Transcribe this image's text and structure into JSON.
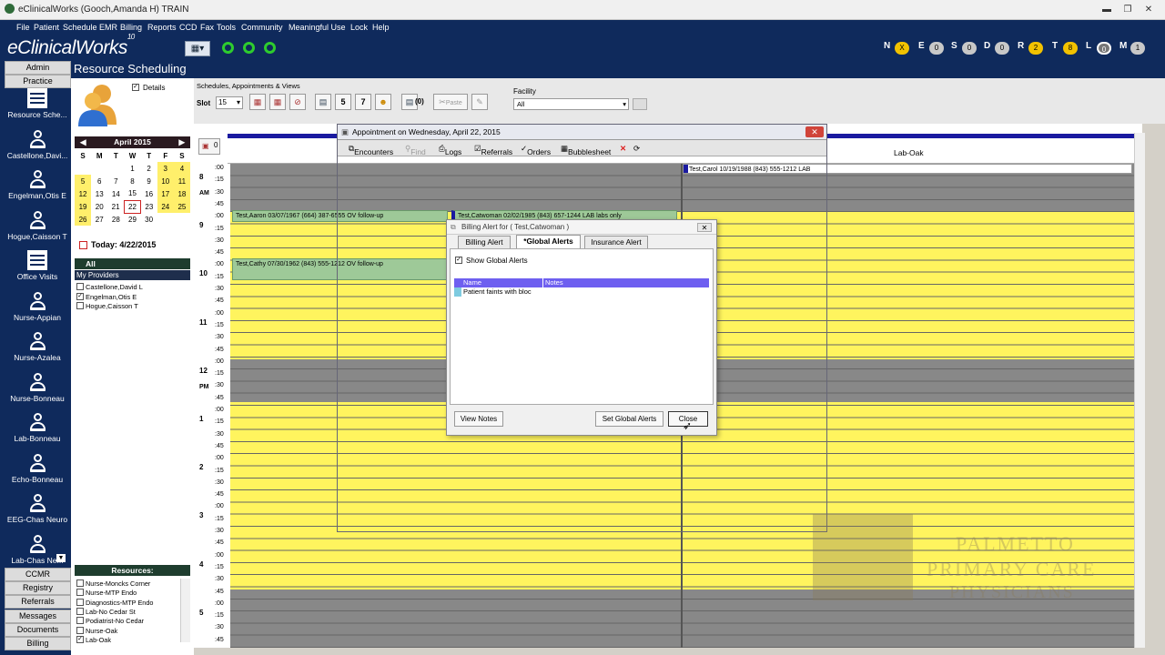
{
  "window": {
    "title": "eClinicalWorks (Gooch,Amanda H)  TRAIN",
    "minimize": "▬",
    "maximize": "❐",
    "close": "✕"
  },
  "menu": [
    "File",
    "Patient",
    "Schedule",
    "EMR",
    "Billing",
    "Reports",
    "CCD",
    "Fax",
    "Tools",
    "Community",
    "Meaningful Use",
    "Lock",
    "Help"
  ],
  "logo": {
    "name": "eClinicalWorks",
    "version": "10"
  },
  "jellybeans": [
    {
      "letter": "N",
      "count": "X",
      "style": "y"
    },
    {
      "letter": "E",
      "count": "0",
      "style": ""
    },
    {
      "letter": "S",
      "count": "0",
      "style": ""
    },
    {
      "letter": "D",
      "count": "0",
      "style": ""
    },
    {
      "letter": "R",
      "count": "2",
      "style": "y"
    },
    {
      "letter": "T",
      "count": "8",
      "style": "y"
    },
    {
      "letter": "L",
      "count": "0",
      "style": "b"
    },
    {
      "letter": "M",
      "count": "1",
      "style": ""
    }
  ],
  "nav": {
    "top_buttons": [
      "Admin",
      "Practice"
    ],
    "items": [
      "Resource Sche...",
      "Castellone,Davi...",
      "Engelman,Otis E",
      "Hogue,Caisson T",
      "Office Visits",
      "Nurse-Appian",
      "Nurse-Azalea",
      "Nurse-Bonneau",
      "Lab-Bonneau",
      "Echo-Bonneau",
      "EEG-Chas Neuro",
      "Lab-Chas Ne..."
    ],
    "bottom_buttons": [
      "CCMR",
      "Registry",
      "Referrals",
      "Messages",
      "Documents",
      "Billing"
    ]
  },
  "header": {
    "title": "Resource Scheduling"
  },
  "left_panel": {
    "details_label": "Details",
    "month": "April 2015",
    "weekdays": [
      "S",
      "M",
      "T",
      "W",
      "T",
      "F",
      "S"
    ],
    "weeks": [
      [
        "",
        "",
        "",
        "1",
        "2",
        "3",
        "4"
      ],
      [
        "5",
        "6",
        "7",
        "8",
        "9",
        "10",
        "11"
      ],
      [
        "12",
        "13",
        "14",
        "15",
        "16",
        "17",
        "18"
      ],
      [
        "19",
        "20",
        "21",
        "22",
        "23",
        "24",
        "25"
      ],
      [
        "26",
        "27",
        "28",
        "29",
        "30",
        "",
        ""
      ]
    ],
    "today_label": "Today: 4/22/2015",
    "all_label": "All",
    "my_providers_label": "My Providers",
    "providers": [
      {
        "name": "Castellone,David L",
        "checked": false
      },
      {
        "name": "Engelman,Otis E",
        "checked": true
      },
      {
        "name": "Hogue,Caisson T",
        "checked": false
      }
    ],
    "resources_label": "Resources:",
    "resources": [
      {
        "name": "Nurse-Moncks Corner",
        "checked": false
      },
      {
        "name": "Nurse-MTP Endo",
        "checked": false
      },
      {
        "name": "Diagnostics-MTP Endo",
        "checked": false
      },
      {
        "name": "Lab-No Cedar St",
        "checked": false
      },
      {
        "name": "Podiatrist-No Cedar",
        "checked": false
      },
      {
        "name": "Nurse-Oak",
        "checked": false
      },
      {
        "name": "Lab-Oak",
        "checked": true
      }
    ]
  },
  "toolbar": {
    "group_label": "Schedules, Appointments & Views",
    "slot_label": "Slot",
    "slot_value": "15",
    "paste_label": "Paste",
    "facility_label": "Facility",
    "facility_value": "All",
    "view_count": "(0)"
  },
  "schedule": {
    "column_header": "Lab-Oak",
    "counter": "0",
    "hours": [
      {
        "hour": "8",
        "ampm": "AM"
      },
      {
        "hour": "9",
        "ampm": ""
      },
      {
        "hour": "10",
        "ampm": ""
      },
      {
        "hour": "11",
        "ampm": ""
      },
      {
        "hour": "12",
        "ampm": "PM"
      },
      {
        "hour": "1",
        "ampm": ""
      },
      {
        "hour": "2",
        "ampm": ""
      },
      {
        "hour": "3",
        "ampm": ""
      },
      {
        "hour": "4",
        "ampm": ""
      },
      {
        "hour": "5",
        "ampm": ""
      }
    ],
    "minutes": [
      ":00",
      ":15",
      ":30",
      ":45"
    ],
    "appointments": [
      {
        "text": "Test,Aaron  03/07/1967 (664) 387-6555 OV follow-up"
      },
      {
        "text": "Test,Catwoman  02/02/1985 (843) 657-1244 LAB labs only"
      },
      {
        "text": "Test,Cathy  07/30/1962 (843) 555-1212 OV follow-up"
      }
    ],
    "lab_appt": "Test,Carol  10/19/1988 (843) 555-1212 LAB"
  },
  "appt_window": {
    "title": "Appointment on Wednesday, April 22, 2015",
    "toolbar": [
      "Encounters",
      "Find",
      "Logs",
      "Referrals",
      "Orders",
      "Bubblesheet"
    ]
  },
  "dialog": {
    "title": "Billing Alert for ( Test,Catwoman )",
    "tabs": [
      "Billing Alert",
      "*Global Alerts",
      "Insurance Alert"
    ],
    "show_global_label": "Show Global Alerts",
    "columns": [
      "Name",
      "Notes"
    ],
    "rows": [
      {
        "name": "Patient faints with bloc",
        "notes": ""
      }
    ],
    "buttons": {
      "view_notes": "View Notes",
      "set_global": "Set Global Alerts",
      "close": "Close"
    }
  },
  "watermark": {
    "lines": [
      "PALMETTO",
      "PRIMARY CARE",
      "PHYSICIANS"
    ]
  },
  "colors": {
    "navy": "#0f2a5c",
    "slot_yellow": "#fff45e",
    "appt_green": "#9ec998"
  }
}
